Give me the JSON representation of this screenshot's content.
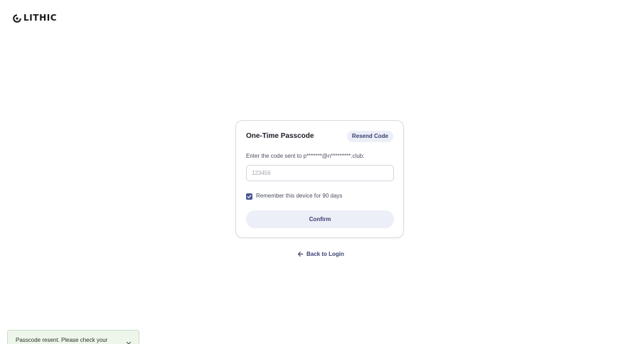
{
  "brand": {
    "name": "LITHIC",
    "logo_icon": "lithic-logo-icon"
  },
  "card": {
    "title": "One-Time Passcode",
    "resend_label": "Resend Code",
    "instructions": "Enter the code sent to p*******@n*********.club:",
    "code_input": {
      "value": "",
      "placeholder": "123456"
    },
    "remember": {
      "checked": true,
      "label": "Remember this device for 90 days"
    },
    "confirm_label": "Confirm"
  },
  "back_link": {
    "label": "Back to Login",
    "icon": "arrow-left-icon"
  },
  "toast": {
    "message": "Passcode resent. Please check your",
    "close_icon": "close-icon"
  },
  "colors": {
    "accent": "#3a4171",
    "accent_soft": "#eceef8",
    "checkbox": "#4a5691",
    "toast_bg": "#eef6ec"
  }
}
